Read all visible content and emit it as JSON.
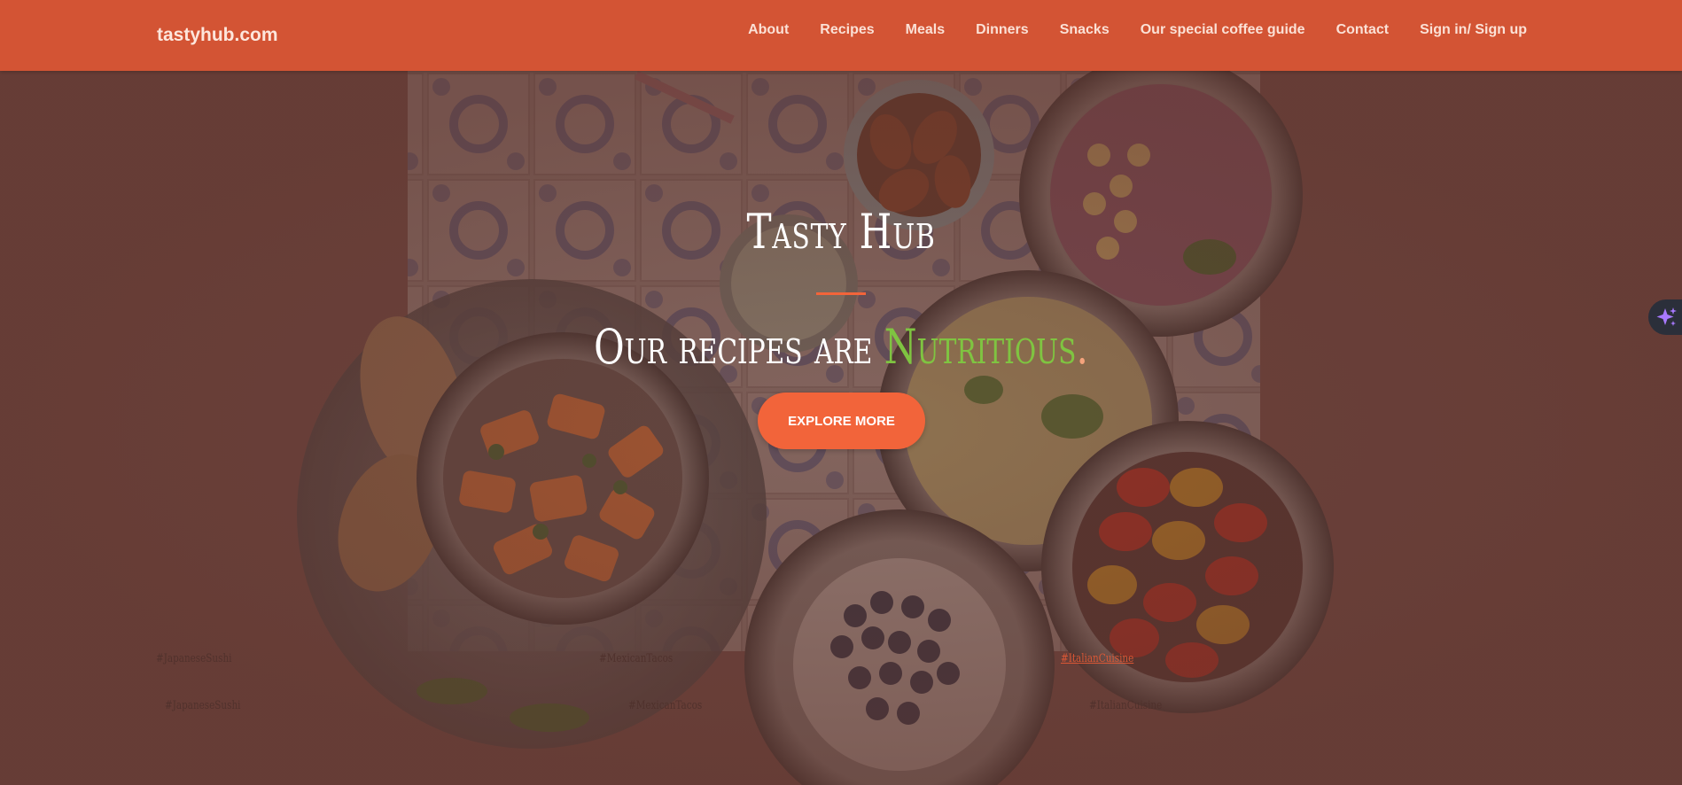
{
  "site": {
    "brand": "tastyhub.com"
  },
  "nav": {
    "items": [
      {
        "label": "About"
      },
      {
        "label": "Recipes"
      },
      {
        "label": "Meals"
      },
      {
        "label": "Dinners"
      },
      {
        "label": "Snacks"
      },
      {
        "label": "Our special coffee guide"
      },
      {
        "label": "Contact"
      },
      {
        "label": "Sign in/ Sign up"
      }
    ]
  },
  "hero": {
    "title": "Tasty Hub",
    "tagline_prefix": "Our recipes are ",
    "tagline_highlight": "Nutritious",
    "tagline_suffix": ".",
    "button_label": "EXPLORE MORE"
  },
  "hashtags": [
    {
      "label": "#JapaneseSushi"
    },
    {
      "label": "#MexicanTacos"
    },
    {
      "label": "#ItalianCuisine"
    },
    {
      "label": "#JapaneseSushi"
    },
    {
      "label": "#MexicanTacos"
    },
    {
      "label": "#ItalianCuisine"
    }
  ],
  "colors": {
    "navbar": "#d35434",
    "accent": "#f2643a",
    "highlight": "#7fc441",
    "overlay": "#6a453f"
  },
  "icons": {
    "assistant": "sparkle-icon"
  }
}
